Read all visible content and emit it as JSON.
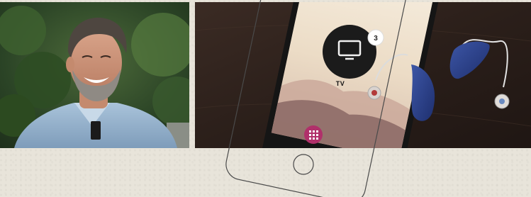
{
  "left_photo": {
    "alt": "Smiling man"
  },
  "right_photo": {
    "program": {
      "label": "TV",
      "count": "3"
    }
  },
  "colors": {
    "background": "#e8e4da",
    "hearing_aid": "#2a3f86",
    "app_button": "#b0306a",
    "phone_frame": "#1a1a1a"
  }
}
